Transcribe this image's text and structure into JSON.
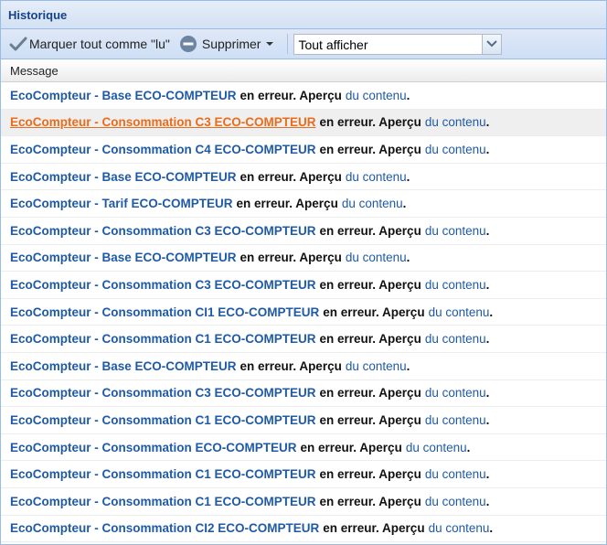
{
  "panel": {
    "title": "Historique"
  },
  "toolbar": {
    "mark_all_label": "Marquer tout comme \"lu\"",
    "delete_label": "Supprimer",
    "filter_value": "Tout afficher"
  },
  "grid": {
    "column_header": "Message",
    "middle_text": "en erreur. Aperçu",
    "link_text": "du contenu",
    "rows": [
      {
        "source": "EcoCompteur - Base ECO-COMPTEUR"
      },
      {
        "source": "EcoCompteur - Consommation C3 ECO-COMPTEUR",
        "selected": true
      },
      {
        "source": "EcoCompteur - Consommation C4 ECO-COMPTEUR"
      },
      {
        "source": "EcoCompteur - Base ECO-COMPTEUR"
      },
      {
        "source": "EcoCompteur - Tarif ECO-COMPTEUR"
      },
      {
        "source": "EcoCompteur - Consommation C3 ECO-COMPTEUR"
      },
      {
        "source": "EcoCompteur - Base ECO-COMPTEUR"
      },
      {
        "source": "EcoCompteur - Consommation C3 ECO-COMPTEUR"
      },
      {
        "source": "EcoCompteur - Consommation CI1 ECO-COMPTEUR"
      },
      {
        "source": "EcoCompteur - Consommation C1 ECO-COMPTEUR"
      },
      {
        "source": "EcoCompteur - Base ECO-COMPTEUR"
      },
      {
        "source": "EcoCompteur - Consommation C3 ECO-COMPTEUR"
      },
      {
        "source": "EcoCompteur - Consommation C1 ECO-COMPTEUR"
      },
      {
        "source": "EcoCompteur - Consommation ECO-COMPTEUR"
      },
      {
        "source": "EcoCompteur - Consommation C1 ECO-COMPTEUR"
      },
      {
        "source": "EcoCompteur - Consommation C1 ECO-COMPTEUR"
      },
      {
        "source": "EcoCompteur - Consommation CI2 ECO-COMPTEUR"
      }
    ]
  },
  "colors": {
    "link": "#1f5aa6",
    "selected_link": "#e96c1b",
    "title": "#15428b"
  },
  "icons": [
    "check-icon",
    "minus-circle-icon",
    "arrow-down-icon",
    "chevron-down-icon"
  ]
}
